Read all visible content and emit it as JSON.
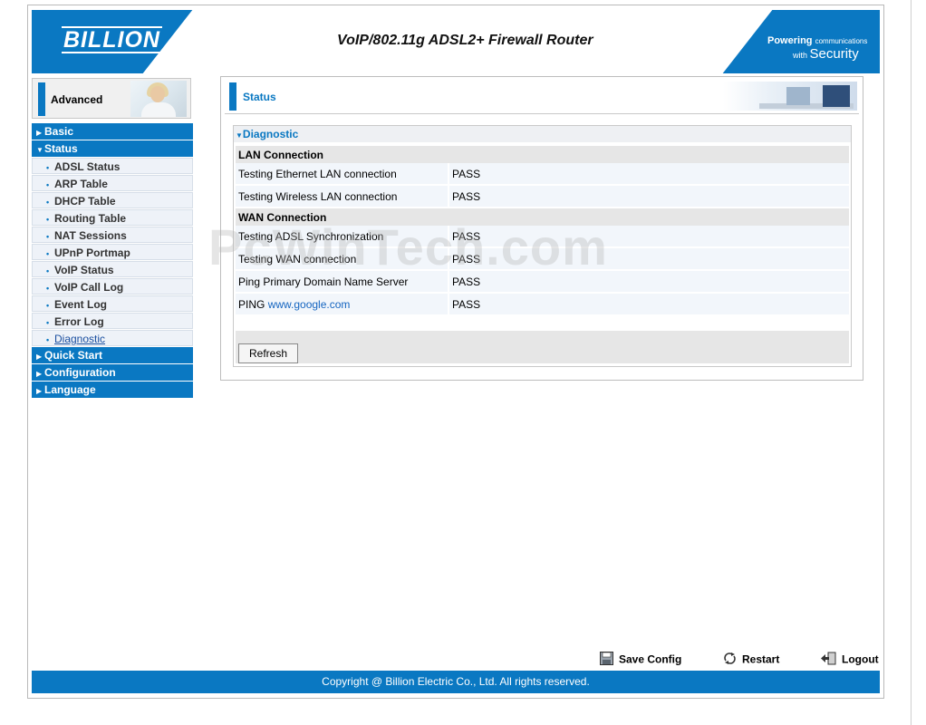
{
  "header": {
    "logo": "BILLION",
    "product_title": "VoIP/802.11g ADSL2+ Firewall Router",
    "tagline_word1": "Powering",
    "tagline_word2": "communications",
    "tagline_word3": "with",
    "tagline_word4": "Security"
  },
  "sidebar": {
    "mode_label": "Advanced",
    "menu": [
      {
        "label": "Basic",
        "kind": "top",
        "icon": "right-triangle-icon"
      },
      {
        "label": "Status",
        "kind": "top",
        "icon": "down-triangle-icon"
      },
      {
        "label": "ADSL Status",
        "kind": "sub"
      },
      {
        "label": "ARP Table",
        "kind": "sub"
      },
      {
        "label": "DHCP Table",
        "kind": "sub"
      },
      {
        "label": "Routing Table",
        "kind": "sub"
      },
      {
        "label": "NAT Sessions",
        "kind": "sub"
      },
      {
        "label": "UPnP Portmap",
        "kind": "sub"
      },
      {
        "label": "VoIP Status",
        "kind": "sub"
      },
      {
        "label": "VoIP Call Log",
        "kind": "sub"
      },
      {
        "label": "Event Log",
        "kind": "sub"
      },
      {
        "label": "Error Log",
        "kind": "sub"
      },
      {
        "label": "Diagnostic",
        "kind": "sub",
        "current": true
      },
      {
        "label": "Quick Start",
        "kind": "top",
        "icon": "right-triangle-icon"
      },
      {
        "label": "Configuration",
        "kind": "top",
        "icon": "right-triangle-icon"
      },
      {
        "label": "Language",
        "kind": "top",
        "icon": "right-triangle-icon"
      }
    ]
  },
  "main": {
    "page_title": "Status",
    "section_title": "Diagnostic",
    "lan_header": "LAN Connection",
    "lan_rows": [
      {
        "label": "Testing Ethernet LAN connection",
        "value": "PASS"
      },
      {
        "label": "Testing Wireless LAN connection",
        "value": "PASS"
      }
    ],
    "wan_header": "WAN Connection",
    "wan_rows": [
      {
        "label": "Testing ADSL Synchronization",
        "value": "PASS"
      },
      {
        "label": "Testing WAN connection",
        "value": "PASS"
      },
      {
        "label": "Ping Primary Domain Name Server",
        "value": "PASS"
      }
    ],
    "ping_prefix": "PING",
    "ping_link": "www.google.com",
    "ping_value": "PASS",
    "refresh_label": "Refresh"
  },
  "watermark": "PcWinTech.com",
  "footer": {
    "save_label": "Save Config",
    "restart_label": "Restart",
    "logout_label": "Logout",
    "copyright": "Copyright @ Billion Electric Co., Ltd. All rights reserved."
  },
  "colors": {
    "brand_blue": "#0a78c2",
    "submenu_bg": "#eef2f8",
    "row_bg": "#f2f6fb",
    "section_bg": "#e6e6e6"
  }
}
